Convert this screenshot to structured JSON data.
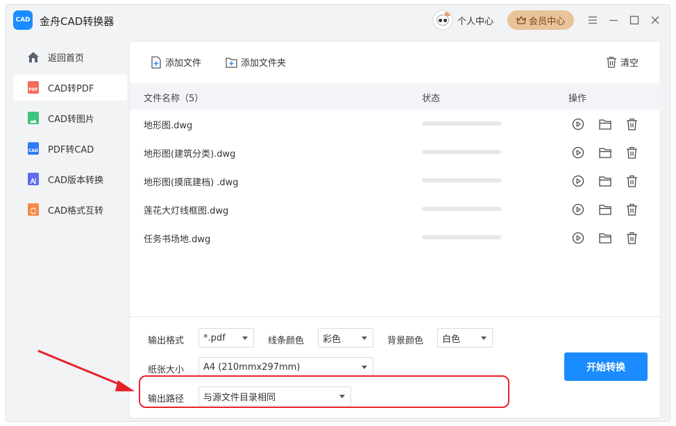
{
  "app": {
    "title": "金舟CAD转换器",
    "logo_text": "CAD"
  },
  "header": {
    "user_center": "个人中心",
    "vip": "会员中心"
  },
  "sidebar": {
    "items": [
      {
        "label": "返回首页",
        "icon": "home-icon"
      },
      {
        "label": "CAD转PDF",
        "icon": "pdf-file-icon",
        "badge": "PDF",
        "color": "#f26b5b"
      },
      {
        "label": "CAD转图片",
        "icon": "image-file-icon",
        "color": "#3cc47c"
      },
      {
        "label": "PDF转CAD",
        "icon": "cad-file-icon",
        "badge": "CAD",
        "color": "#2f7bf5"
      },
      {
        "label": "CAD版本转换",
        "icon": "version-file-icon",
        "color": "#5b6cf2"
      },
      {
        "label": "CAD格式互转",
        "icon": "format-file-icon",
        "color": "#f5894a"
      }
    ]
  },
  "toolbar": {
    "add_file": "添加文件",
    "add_folder": "添加文件夹",
    "clear": "清空"
  },
  "table": {
    "headers": {
      "name": "文件名称（5）",
      "status": "状态",
      "action": "操作"
    },
    "rows": [
      {
        "name": "地形图.dwg",
        "progress": 0
      },
      {
        "name": "地形图(建筑分类).dwg",
        "progress": 0
      },
      {
        "name": "地形图(摸底建档) .dwg",
        "progress": 0
      },
      {
        "name": "莲花大灯线框图.dwg",
        "progress": 0
      },
      {
        "name": "任务书场地.dwg",
        "progress": 0
      }
    ]
  },
  "settings": {
    "output_format": {
      "label": "输出格式",
      "value": "*.pdf"
    },
    "line_color": {
      "label": "线条颜色",
      "value": "彩色"
    },
    "bg_color": {
      "label": "背景颜色",
      "value": "白色"
    },
    "paper_size": {
      "label": "纸张大小",
      "value": "A4 (210mmx297mm)"
    },
    "output_path": {
      "label": "输出路径",
      "value": "与源文件目录相同"
    },
    "start": "开始转换"
  },
  "colors": {
    "accent": "#1a8cff",
    "annotation": "#e8202a",
    "vip": "#e9c39a"
  }
}
